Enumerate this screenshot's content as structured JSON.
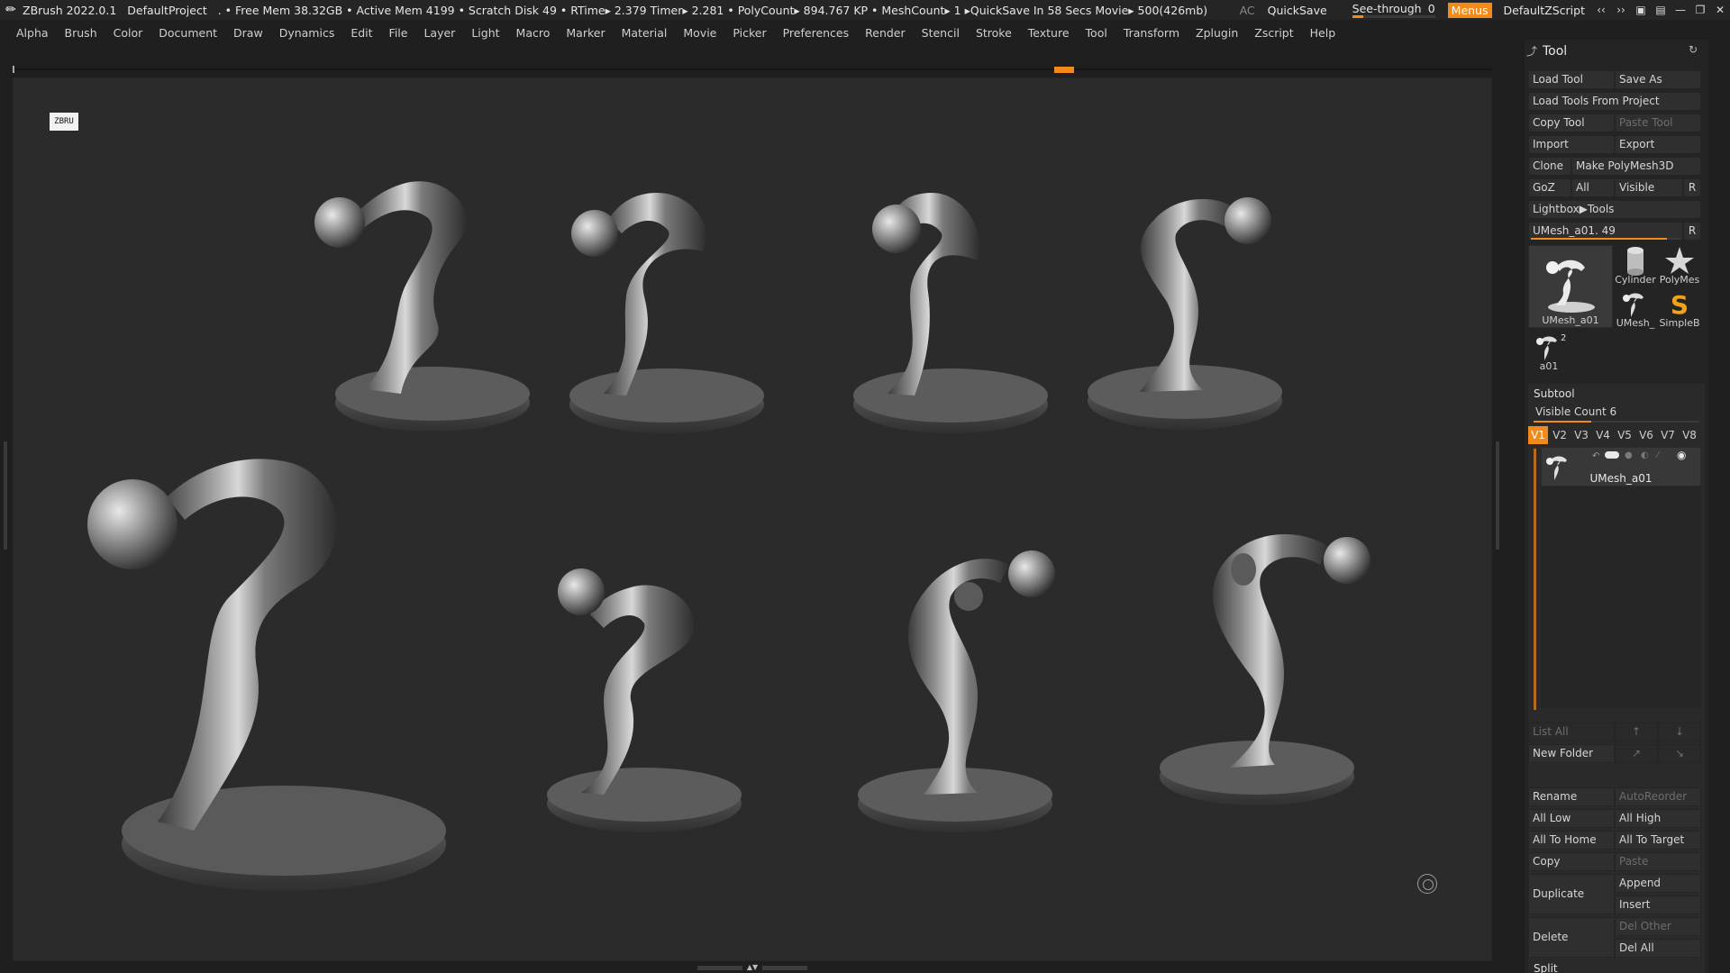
{
  "titlebar": {
    "app": "ZBrush 2022.0.1",
    "project": "DefaultProject",
    "status": ". • Free Mem 38.32GB • Active Mem 4199 • Scratch Disk 49 •  RTime▸ 2.379 Timer▸ 2.281 • PolyCount▸ 894.767 KP  • MeshCount▸ 1  ▸QuickSave In 58 Secs Movie▸ 500(426mb)",
    "ac": "AC",
    "quicksave": "QuickSave",
    "seethrough_label": "See-through",
    "seethrough_value": "0",
    "seethrough_level": 0.0,
    "menus": "Menus",
    "zscript": "DefaultZScript"
  },
  "menu": [
    "Alpha",
    "Brush",
    "Color",
    "Document",
    "Draw",
    "Dynamics",
    "Edit",
    "File",
    "Layer",
    "Light",
    "Macro",
    "Marker",
    "Material",
    "Movie",
    "Picker",
    "Preferences",
    "Render",
    "Stencil",
    "Stroke",
    "Texture",
    "Tool",
    "Transform",
    "Zplugin",
    "Zscript",
    "Help"
  ],
  "viewport": {
    "corner_icon_text": "ZBRU"
  },
  "tool": {
    "title": "Tool",
    "load_tool": "Load Tool",
    "save_as": "Save As",
    "load_from_project": "Load Tools From Project",
    "copy_tool": "Copy Tool",
    "paste_tool": "Paste Tool",
    "import": "Import",
    "export": "Export",
    "clone": "Clone",
    "make_polymesh": "Make PolyMesh3D",
    "goz": "GoZ",
    "all": "All",
    "visible": "Visible",
    "r": "R",
    "lightbox_tools": "Lightbox▶Tools",
    "current_tool": "UMesh_a01. 49",
    "current_tool_level": 0.9,
    "thumbs": {
      "main": "UMesh_a01",
      "cylinder": "Cylinder",
      "polymesh": "PolyMes",
      "umesh": "UMesh_",
      "simpleb": "SimpleB",
      "a01": "a01",
      "a01_count": "2"
    }
  },
  "subtool": {
    "title": "Subtool",
    "visible_count": "Visible Count 6",
    "visible_level": 0.35,
    "tabs": [
      "V1",
      "V2",
      "V3",
      "V4",
      "V5",
      "V6",
      "V7",
      "V8"
    ],
    "active_tab": "V1",
    "item_name": "UMesh_a01",
    "list_all": "List All",
    "new_folder": "New Folder",
    "rename": "Rename",
    "autoreorder": "AutoReorder",
    "all_low": "All Low",
    "all_high": "All High",
    "all_to_home": "All To Home",
    "all_to_target": "All To Target",
    "copy": "Copy",
    "paste": "Paste",
    "duplicate": "Duplicate",
    "append": "Append",
    "insert": "Insert",
    "delete": "Delete",
    "del_other": "Del Other",
    "del_all": "Del All",
    "split": "Split"
  },
  "colors": {
    "accent": "#f28a1a",
    "background": "#2b2b2b",
    "panel": "#242424"
  }
}
